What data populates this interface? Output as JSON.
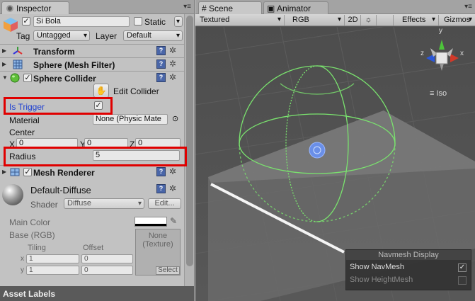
{
  "inspector": {
    "tab_label": "Inspector",
    "object_name": "Si Bola",
    "static_label": "Static",
    "tag_label": "Tag",
    "tag_value": "Untagged",
    "layer_label": "Layer",
    "layer_value": "Default"
  },
  "components": {
    "transform": "Transform",
    "mesh_filter": "Sphere (Mesh Filter)",
    "sphere_collider": "Sphere Collider",
    "mesh_renderer": "Mesh Renderer"
  },
  "collider": {
    "edit_collider": "Edit Collider",
    "is_trigger_label": "Is Trigger",
    "is_trigger_checked": true,
    "material_label": "Material",
    "material_value": "None (Physic Mate",
    "center_label": "Center",
    "center_x_label": "X",
    "center_x": "0",
    "center_y_label": "Y",
    "center_y": "0",
    "center_z_label": "Z",
    "center_z": "0",
    "radius_label": "Radius",
    "radius_value": "5"
  },
  "material": {
    "name": "Default-Diffuse",
    "shader_label": "Shader",
    "shader_value": "Diffuse",
    "edit_button": "Edit...",
    "main_color_label": "Main Color",
    "base_label": "Base (RGB)",
    "tiling_label": "Tiling",
    "offset_label": "Offset",
    "x_label": "x",
    "y_label": "y",
    "tiling_x": "1",
    "tiling_y": "1",
    "offset_x": "0",
    "offset_y": "0",
    "texture_none": "None",
    "texture_type": "(Texture)",
    "select_button": "Select"
  },
  "asset_labels": "Asset Labels",
  "scene": {
    "tab_scene": "Scene",
    "tab_animator": "Animator",
    "shading_mode": "Textured",
    "render_mode": "RGB",
    "btn_2d": "2D",
    "effects": "Effects",
    "gizmos": "Gizmos",
    "iso_label": "Iso",
    "axis_x": "x",
    "axis_y": "y",
    "axis_z": "z"
  },
  "navmesh": {
    "title": "Navmesh Display",
    "show_navmesh": "Show NavMesh",
    "show_navmesh_checked": true,
    "show_heightmesh": "Show HeightMesh",
    "show_heightmesh_checked": false
  },
  "colors": {
    "highlight_box": "#e00000",
    "collider_wire": "#7ae36e",
    "is_trigger_text": "#1d3fd1"
  }
}
